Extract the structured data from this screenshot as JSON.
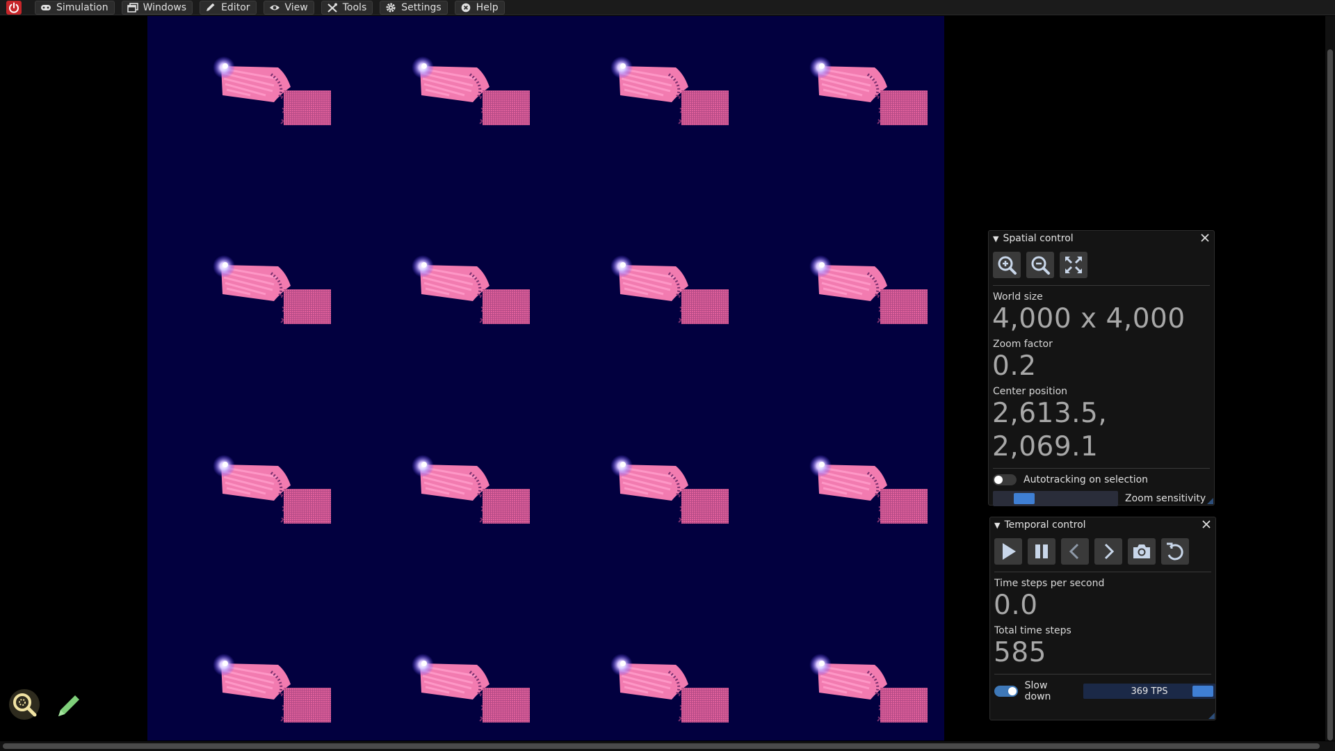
{
  "menu": {
    "items": [
      {
        "label": "Simulation",
        "icon": "gamepad-icon"
      },
      {
        "label": "Windows",
        "icon": "windows-icon"
      },
      {
        "label": "Editor",
        "icon": "pencil-icon"
      },
      {
        "label": "View",
        "icon": "eye-icon"
      },
      {
        "label": "Tools",
        "icon": "tools-icon"
      },
      {
        "label": "Settings",
        "icon": "gear-icon"
      },
      {
        "label": "Help",
        "icon": "help-icon"
      }
    ]
  },
  "spatial": {
    "title": "Spatial control",
    "world_size_label": "World size",
    "world_size": "4,000 x 4,000",
    "zoom_factor_label": "Zoom factor",
    "zoom_factor": "0.2",
    "center_label": "Center position",
    "center": "2,613.5, 2,069.1",
    "autotracking_label": "Autotracking on selection",
    "autotracking_on": false,
    "zoom_sensitivity_label": "Zoom sensitivity",
    "zoom_sensitivity_level": 0.2
  },
  "temporal": {
    "title": "Temporal control",
    "tps_label": "Time steps per second",
    "tps": "0.0",
    "total_label": "Total time steps",
    "total": "585",
    "slowdown_label": "Slow down",
    "slowdown_on": true,
    "slowdown_value": "369 TPS",
    "slowdown_level": 0.97
  },
  "colors": {
    "world_bg": "#02003f",
    "pattern_pink": "#f06aa6",
    "accent_blue": "#3f7fd4"
  }
}
